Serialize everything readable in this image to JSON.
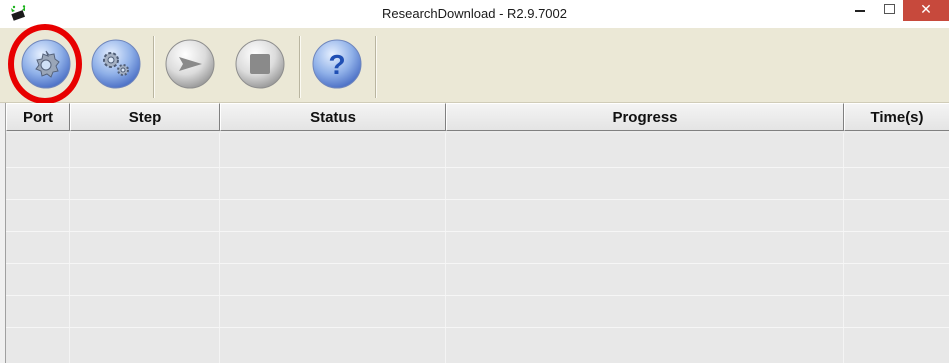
{
  "window": {
    "title": "ResearchDownload - R2.9.7002",
    "close_glyph": "✕",
    "app_icon": "phone-arrow-icon"
  },
  "toolbar": {
    "buttons": [
      {
        "name": "load-packet-button",
        "icon": "gear-icon"
      },
      {
        "name": "settings-button",
        "icon": "gears-icon"
      },
      {
        "name": "start-button",
        "icon": "play-arrow-icon"
      },
      {
        "name": "stop-button",
        "icon": "stop-square-icon"
      },
      {
        "name": "help-button",
        "icon": "question-icon",
        "glyph": "?"
      }
    ],
    "highlight_color": "#e80000"
  },
  "table": {
    "columns": [
      "Port",
      "Step",
      "Status",
      "Progress",
      "Time(s)"
    ],
    "rows": []
  }
}
